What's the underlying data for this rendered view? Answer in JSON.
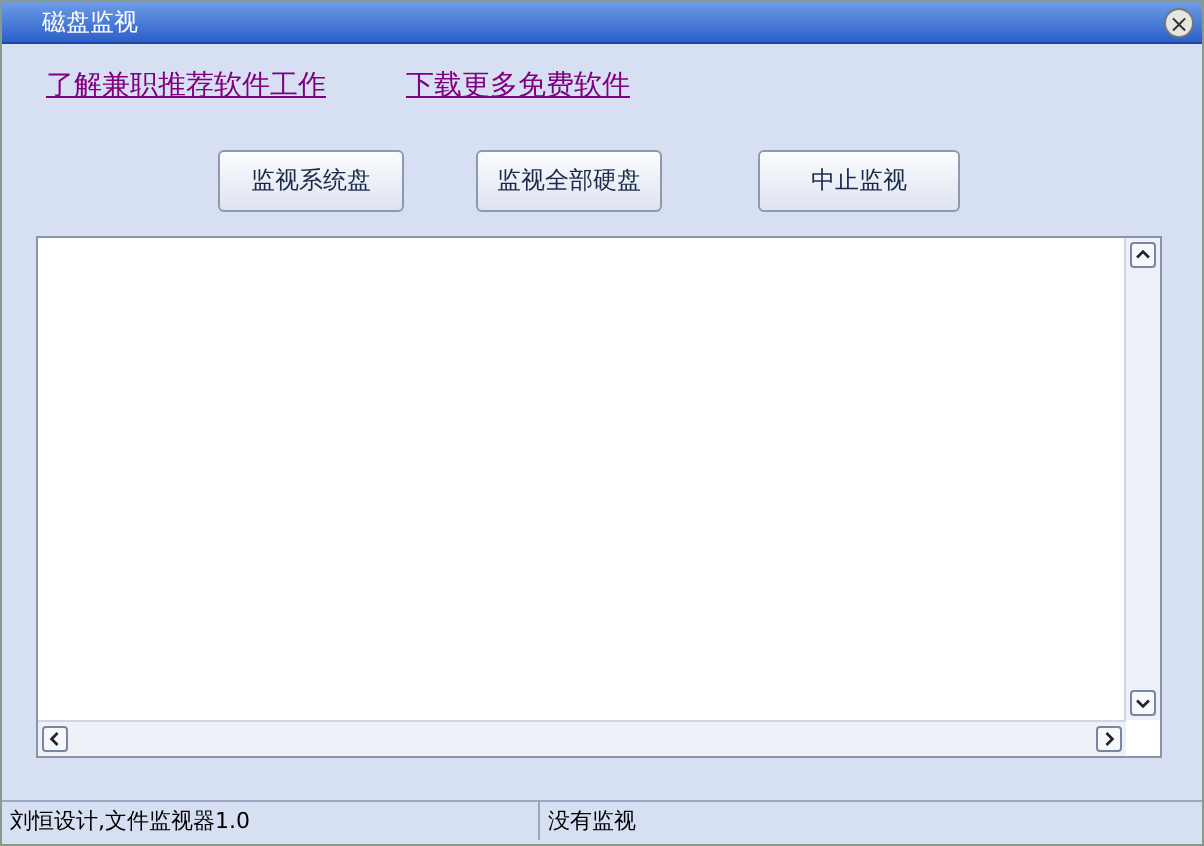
{
  "window": {
    "title": "磁盘监视",
    "close": "×"
  },
  "links": [
    "了解兼职推荐软件工作",
    "下载更多免费软件"
  ],
  "buttons": [
    "监视系统盘",
    "监视全部硬盘",
    "中止监视"
  ],
  "status_bar": [
    "刘恒设计,文件监视器1.0",
    "没有监视"
  ]
}
